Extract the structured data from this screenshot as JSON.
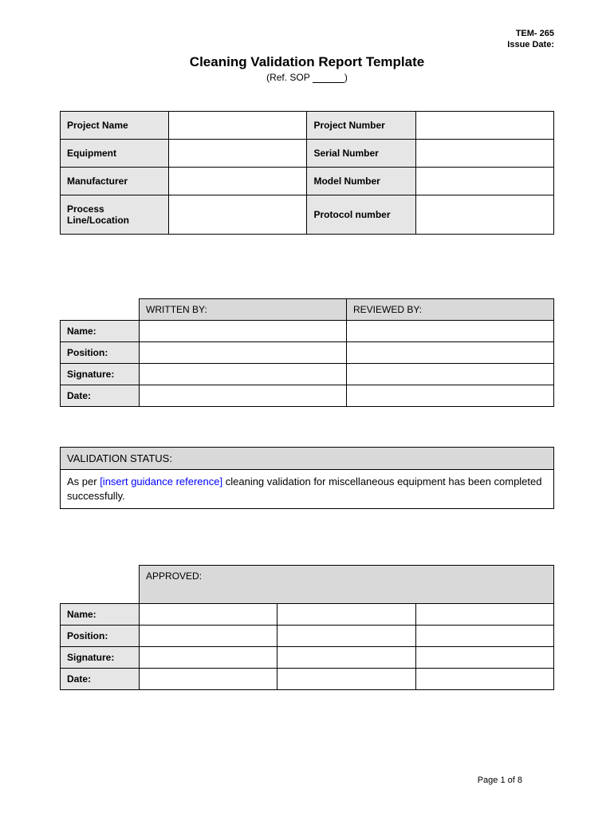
{
  "header": {
    "tem": "TEM- 265",
    "issue_date_label": "Issue Date:"
  },
  "title": "Cleaning Validation Report Template",
  "subtitle_prefix": "(Ref. SOP ",
  "subtitle_suffix": ")",
  "info_table": {
    "rows": [
      {
        "label1": "Project Name",
        "value1": "",
        "label2": "Project Number",
        "value2": ""
      },
      {
        "label1": "Equipment",
        "value1": "",
        "label2": "Serial Number",
        "value2": ""
      },
      {
        "label1": "Manufacturer",
        "value1": "",
        "label2": "Model Number",
        "value2": ""
      },
      {
        "label1": "Process Line/Location",
        "value1": "",
        "label2": "Protocol number",
        "value2": ""
      }
    ]
  },
  "sign_table": {
    "header1": "WRITTEN BY:",
    "header2": "REVIEWED BY:",
    "rows": [
      {
        "label": "Name:",
        "v1": "",
        "v2": ""
      },
      {
        "label": "Position:",
        "v1": "",
        "v2": ""
      },
      {
        "label": "Signature:",
        "v1": "",
        "v2": ""
      },
      {
        "label": "Date:",
        "v1": "",
        "v2": ""
      }
    ]
  },
  "status": {
    "header": "VALIDATION STATUS:",
    "body_prefix": "As per ",
    "body_insert": "[insert guidance reference]",
    "body_suffix": " cleaning validation for miscellaneous equipment has been completed successfully."
  },
  "approve_table": {
    "header": "APPROVED:",
    "rows": [
      {
        "label": "Name:",
        "v1": "",
        "v2": "",
        "v3": ""
      },
      {
        "label": "Position:",
        "v1": "",
        "v2": "",
        "v3": ""
      },
      {
        "label": "Signature:",
        "v1": "",
        "v2": "",
        "v3": ""
      },
      {
        "label": "Date:",
        "v1": "",
        "v2": "",
        "v3": ""
      }
    ]
  },
  "footer": {
    "prefix": "Page ",
    "current": "1",
    "of": " of ",
    "total": "8"
  }
}
